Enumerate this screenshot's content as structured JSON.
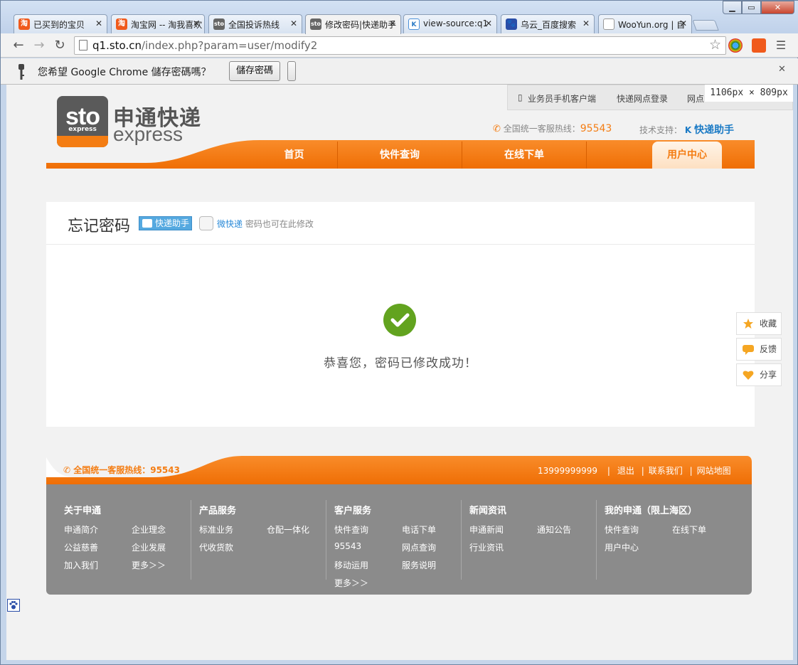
{
  "browser": {
    "tabs": [
      {
        "title": "已买到的宝贝",
        "icon": "taobao-icon"
      },
      {
        "title": "淘宝网 -- 淘我喜欢",
        "icon": "taobao-icon"
      },
      {
        "title": "全国投诉热线",
        "icon": "sto-icon"
      },
      {
        "title": "修改密码|快递助手",
        "icon": "sto-icon"
      },
      {
        "title": "view-source:q1",
        "icon": "kuaidi-icon"
      },
      {
        "title": "乌云_百度搜索",
        "icon": "baidu-icon"
      },
      {
        "title": "WooYun.org | 自",
        "icon": "page-icon"
      }
    ],
    "url_host": "q1.sto.cn",
    "url_path": "/index.php?param=user/modify2",
    "infobar_message": "您希望 Google Chrome 儲存密碼嗎？",
    "infobar_button": "儲存密碼",
    "viewport_size": "1106px × 809px"
  },
  "header": {
    "logo_mark": "sto",
    "logo_sub": "express",
    "logo_cn": "申通快递",
    "logo_en": "express",
    "top_links": [
      "业务员手机客户端",
      "快递网点登录",
      "网点"
    ],
    "hotline_label": "全国统一客服热线：",
    "hotline_number": "95543",
    "tech_label": "技术支持：",
    "tech_brand": "快递助手"
  },
  "nav": [
    "首页",
    "快件查询",
    "在线下单",
    "用户中心"
  ],
  "nav_active": "用户中心",
  "content": {
    "title": "忘记密码",
    "badge": "快递助手",
    "wei_link": "微快递",
    "wei_suffix": " 密码也可在此修改",
    "success_message": "恭喜您，密码已修改成功！"
  },
  "float_buttons": [
    "收藏",
    "反馈",
    "分享"
  ],
  "footer": {
    "hotline": "全国统一客服热线：95543",
    "phone": "13999999999",
    "links": [
      "退出",
      "联系我们",
      "网站地图"
    ],
    "columns": [
      {
        "title": "关于申通",
        "links": [
          "申通简介",
          "企业理念",
          "公益慈善",
          "企业发展",
          "加入我们",
          "更多＞＞"
        ]
      },
      {
        "title": "产品服务",
        "links": [
          "标准业务",
          "仓配一体化",
          "代收货款"
        ]
      },
      {
        "title": "客户服务",
        "links": [
          "快件查询",
          "电话下单",
          "95543",
          "网点查询",
          "移动运用",
          "服务说明",
          "更多＞＞"
        ]
      },
      {
        "title": "新闻资讯",
        "links": [
          "申通新闻",
          "通知公告",
          "行业资讯"
        ]
      },
      {
        "title": "我的申通（限上海区）",
        "links": [
          "快件查询",
          "在线下单",
          "用户中心"
        ]
      }
    ]
  },
  "colors": {
    "brand_orange": "#f47d13",
    "success_green": "#62a31f",
    "footer_gray": "#8b8b8b"
  }
}
